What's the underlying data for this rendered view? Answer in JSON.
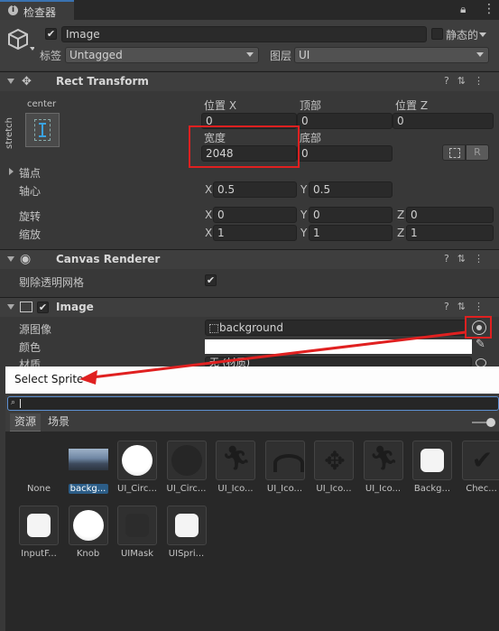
{
  "tab": {
    "title": "检查器"
  },
  "object": {
    "name": "Image",
    "static_label": "静态的",
    "tag_label": "标签",
    "tag_value": "Untagged",
    "layer_label": "图层",
    "layer_value": "UI"
  },
  "rect_transform": {
    "title": "Rect Transform",
    "anchor_h": "center",
    "anchor_v": "stretch",
    "pos_x_label": "位置 X",
    "pos_x": "0",
    "top_label": "顶部",
    "top": "0",
    "pos_z_label": "位置 Z",
    "pos_z": "0",
    "width_label": "宽度",
    "width": "2048",
    "bottom_label": "底部",
    "bottom": "0",
    "r_button": "R",
    "anchors_label": "锚点",
    "pivot_label": "轴心",
    "pivot_x": "0.5",
    "pivot_y": "0.5",
    "rotation_label": "旋转",
    "rot_x": "0",
    "rot_y": "0",
    "rot_z": "0",
    "scale_label": "缩放",
    "scale_x": "1",
    "scale_y": "1",
    "scale_z": "1",
    "axis_x": "X",
    "axis_y": "Y",
    "axis_z": "Z"
  },
  "canvas_renderer": {
    "title": "Canvas Renderer",
    "cull_label": "剔除透明网格"
  },
  "image": {
    "title": "Image",
    "source_label": "源图像",
    "source_value": "background",
    "color_label": "颜色",
    "material_label": "材质",
    "material_value": "无 (材质)"
  },
  "picker": {
    "title": "Select Sprite",
    "search_value": "",
    "tab_assets": "资源",
    "tab_scene": "场景",
    "items": [
      {
        "label": "None",
        "kind": "none"
      },
      {
        "label": "backg...",
        "kind": "photo",
        "selected": true
      },
      {
        "label": "UI_Circ...",
        "kind": "circle-white"
      },
      {
        "label": "UI_Circ...",
        "kind": "circle-dark"
      },
      {
        "label": "UI_Ico...",
        "kind": "icon-runner"
      },
      {
        "label": "UI_Ico...",
        "kind": "icon-eye"
      },
      {
        "label": "UI_Ico...",
        "kind": "icon-move"
      },
      {
        "label": "UI_Ico...",
        "kind": "icon-runner"
      },
      {
        "label": "Backg...",
        "kind": "rounded-white"
      },
      {
        "label": "Chec...",
        "kind": "checkmark"
      },
      {
        "label": "InputF...",
        "kind": "rounded-white"
      },
      {
        "label": "Knob",
        "kind": "circle-white"
      },
      {
        "label": "UIMask",
        "kind": "rounded-dark"
      },
      {
        "label": "UISpri...",
        "kind": "rounded-white"
      }
    ]
  }
}
